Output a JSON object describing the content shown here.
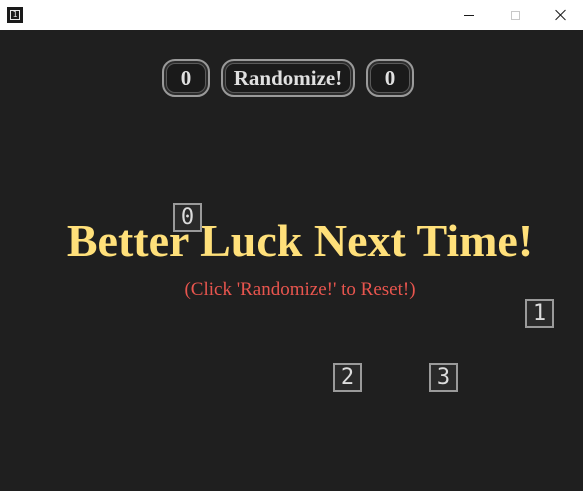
{
  "window": {
    "icon_glyph": "1",
    "icon": "app-icon"
  },
  "controls": {
    "left_counter": "0",
    "randomize_label": "Randomize!",
    "right_counter": "0"
  },
  "tiles": [
    "0",
    "1",
    "2",
    "3"
  ],
  "message": {
    "headline": "Better Luck Next Time!",
    "subline": "(Click 'Randomize!' to Reset!)"
  },
  "colors": {
    "background": "#1f1f1f",
    "headline": "#ffe07a",
    "subline": "#e8554e"
  }
}
